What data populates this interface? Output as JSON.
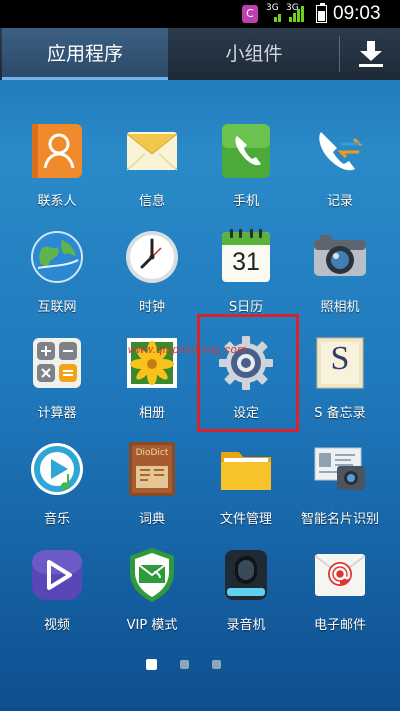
{
  "status_bar": {
    "badge": "C",
    "sim1": "3G",
    "sim2": "3G",
    "time": "09:03"
  },
  "tabs": {
    "apps": "应用程序",
    "widgets": "小组件"
  },
  "apps": [
    {
      "label": "联系人",
      "icon": "contacts-icon"
    },
    {
      "label": "信息",
      "icon": "messages-icon"
    },
    {
      "label": "手机",
      "icon": "phone-icon"
    },
    {
      "label": "记录",
      "icon": "call-log-icon"
    },
    {
      "label": "互联网",
      "icon": "internet-icon"
    },
    {
      "label": "时钟",
      "icon": "clock-icon"
    },
    {
      "label": "S日历",
      "icon": "calendar-icon",
      "day": "31"
    },
    {
      "label": "照相机",
      "icon": "camera-icon"
    },
    {
      "label": "计算器",
      "icon": "calculator-icon"
    },
    {
      "label": "相册",
      "icon": "gallery-icon"
    },
    {
      "label": "设定",
      "icon": "settings-icon"
    },
    {
      "label": "S 备忘录",
      "icon": "s-memo-icon",
      "letter": "S"
    },
    {
      "label": "音乐",
      "icon": "music-icon"
    },
    {
      "label": "词典",
      "icon": "dictionary-icon",
      "brand": "DioDict"
    },
    {
      "label": "文件管理",
      "icon": "file-manager-icon"
    },
    {
      "label": "智能名片识别",
      "icon": "business-card-icon"
    },
    {
      "label": "视频",
      "icon": "video-icon"
    },
    {
      "label": "VIP 模式",
      "icon": "vip-mode-icon"
    },
    {
      "label": "录音机",
      "icon": "voice-recorder-icon"
    },
    {
      "label": "电子邮件",
      "icon": "email-icon"
    }
  ],
  "watermark": "www.qinpinchang.com",
  "pages": {
    "count": 3,
    "active": 0
  },
  "colors": {
    "highlight": "#d8232a",
    "tab_active": "#3b5f83"
  }
}
